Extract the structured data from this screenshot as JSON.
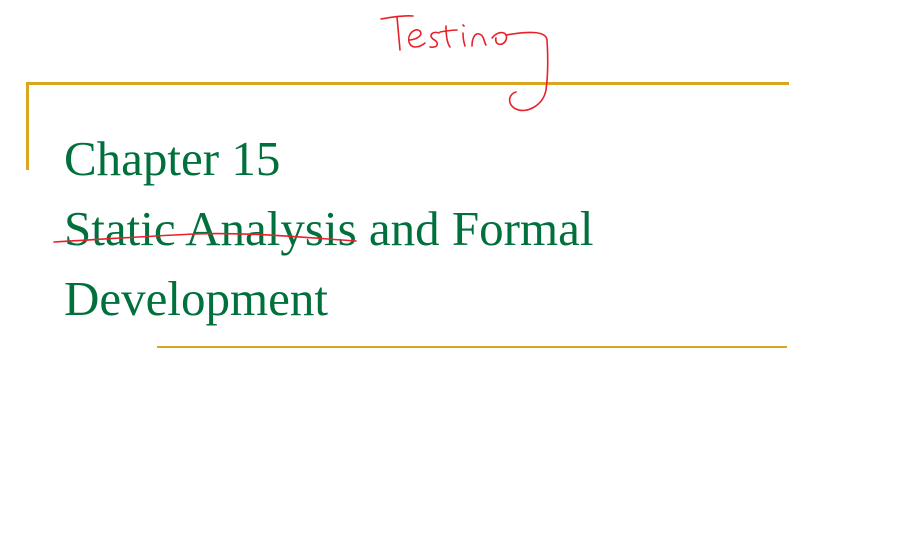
{
  "slide": {
    "annotation_text": "Testing",
    "title_lines": [
      "Chapter 15",
      "Static Analysis and Formal",
      "Development"
    ]
  },
  "colors": {
    "title": "#00703C",
    "rule": "#DAA520",
    "ink": "#E8202A",
    "background": "#FFFFFF"
  }
}
